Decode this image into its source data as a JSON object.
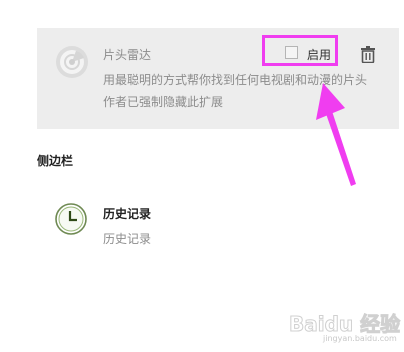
{
  "extension": {
    "name": "片头雷达",
    "description": "用最聪明的方式帮你找到任何电视剧和动漫的片头",
    "warning": "作者已强制隐藏此扩展",
    "enable_label": "启用",
    "enabled": false,
    "icon": "radar-icon"
  },
  "sidebar_section": {
    "title": "侧边栏",
    "items": [
      {
        "title": "历史记录",
        "subtitle": "历史记录",
        "icon": "clock-icon"
      }
    ]
  },
  "annotation": {
    "highlight_color": "#f03df0"
  },
  "watermark": {
    "text": "Baidu 经验",
    "sub": "jingyan.baidu.com"
  }
}
